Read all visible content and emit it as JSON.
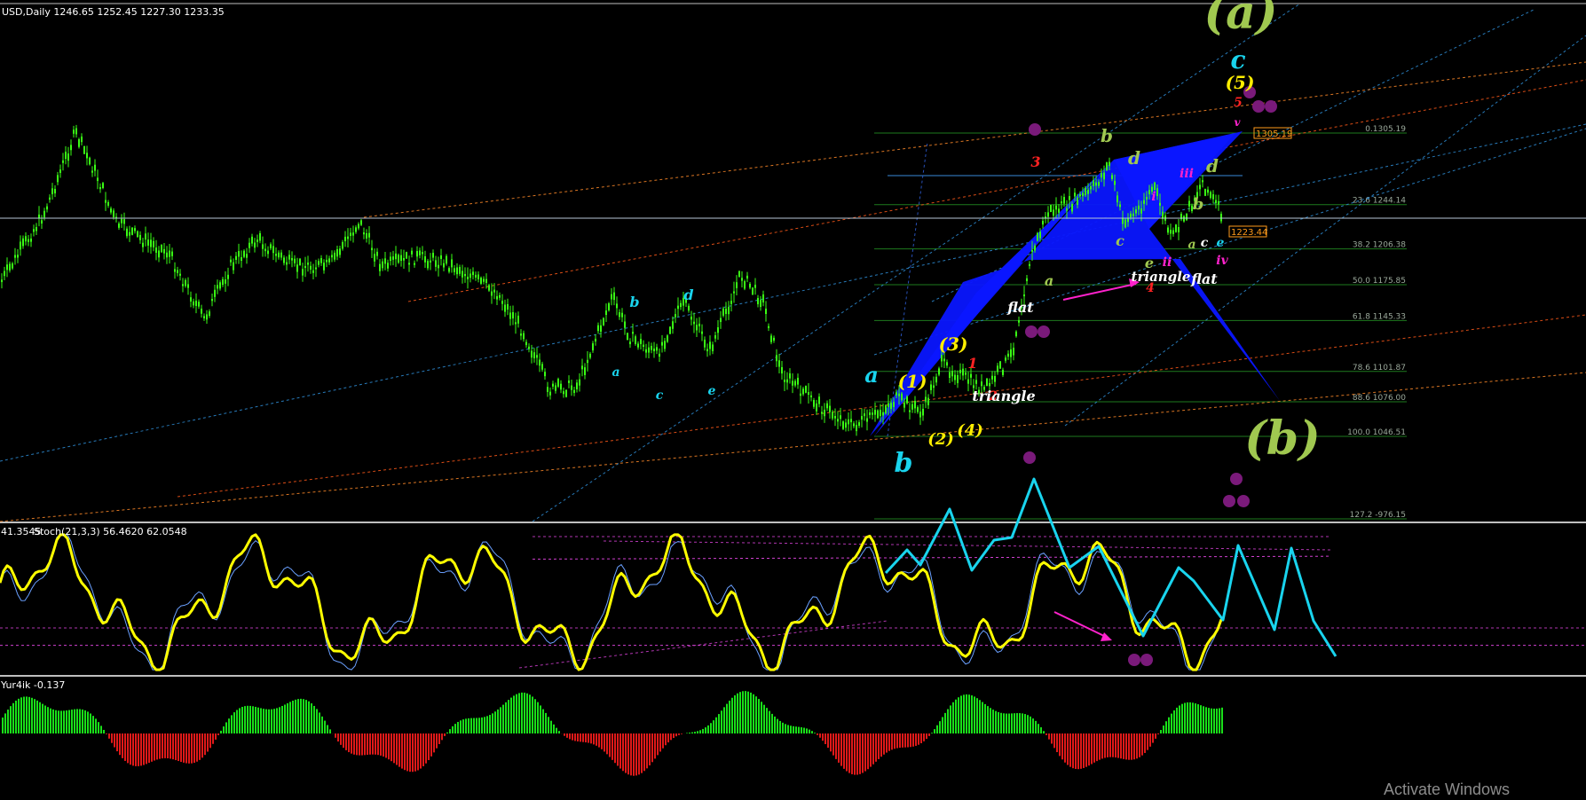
{
  "window": {
    "header": "USD,Daily  1246.65 1252.45 1227.30 1233.35",
    "watermark": "Activate Windows"
  },
  "colors": {
    "background": "#000000",
    "candles": "#39ff14",
    "pattern_fill": "#0a16ff",
    "stoch_main": "#ffff00",
    "stoch_signal": "#6aa0ff",
    "projection": "#19d4ee",
    "arrow": "#ff22cc",
    "dots": "#7a1a7a",
    "hist_up": "#19e019",
    "hist_down": "#e01919",
    "fib_line": "#1e7a1e"
  },
  "price_boxes": [
    {
      "text": "1223.44",
      "color": "#ff9a1a"
    },
    {
      "text": "1305.19",
      "color": "#ff9a1a"
    }
  ],
  "chart_data": [
    {
      "type": "line",
      "title": "USD,Daily",
      "ohlc": {
        "open": 1246.65,
        "high": 1252.45,
        "low": 1227.3,
        "close": 1233.35
      },
      "fib_levels": [
        {
          "label": "0.1305.19",
          "level": 0,
          "price": 1305.19
        },
        {
          "label": "23.6 1244.14",
          "level": 23.6,
          "price": 1244.14
        },
        {
          "label": "38.2 1206.38",
          "level": 38.2,
          "price": 1206.38
        },
        {
          "label": "50.0 1175.85",
          "level": 50.0,
          "price": 1175.85
        },
        {
          "label": "61.8 1145.33",
          "level": 61.8,
          "price": 1145.33
        },
        {
          "label": "78.6 1101.87",
          "level": 78.6,
          "price": 1101.87
        },
        {
          "label": "88.6 1076.00",
          "level": 88.6,
          "price": 1076.0
        },
        {
          "label": "100.0 1046.51",
          "level": 100.0,
          "price": 1046.51
        },
        {
          "label": "127.2 -976.15",
          "level": 127.2,
          "price": 976.15
        }
      ],
      "current_price": 1223.44,
      "wave_labels": [
        "(a)",
        "c",
        "(5)",
        "5",
        "v",
        "b",
        "d",
        "3",
        "iii",
        "d",
        "i",
        "b",
        "c",
        "a",
        "c",
        "e",
        "a",
        "ii",
        "e",
        "iv",
        "4",
        "(3)",
        "1",
        "a",
        "(1)",
        "2",
        "(2)",
        "(4)",
        "b",
        "(b)",
        "b",
        "d",
        "a",
        "c",
        "e"
      ],
      "annotations": [
        "flat",
        "triangle",
        "flat",
        "triangle"
      ]
    },
    {
      "type": "line",
      "title": "Stoch(21,3,3) 56.4620 62.0548",
      "header_prefix": "41.3545",
      "ylim": [
        0,
        100
      ],
      "series": [
        {
          "name": "Stoch(21,3,3)",
          "value": 56.462
        },
        {
          "name": "signal",
          "value": 62.0548
        }
      ]
    },
    {
      "type": "bar",
      "title": "Yur4ik -0.137",
      "value": -0.137
    }
  ]
}
